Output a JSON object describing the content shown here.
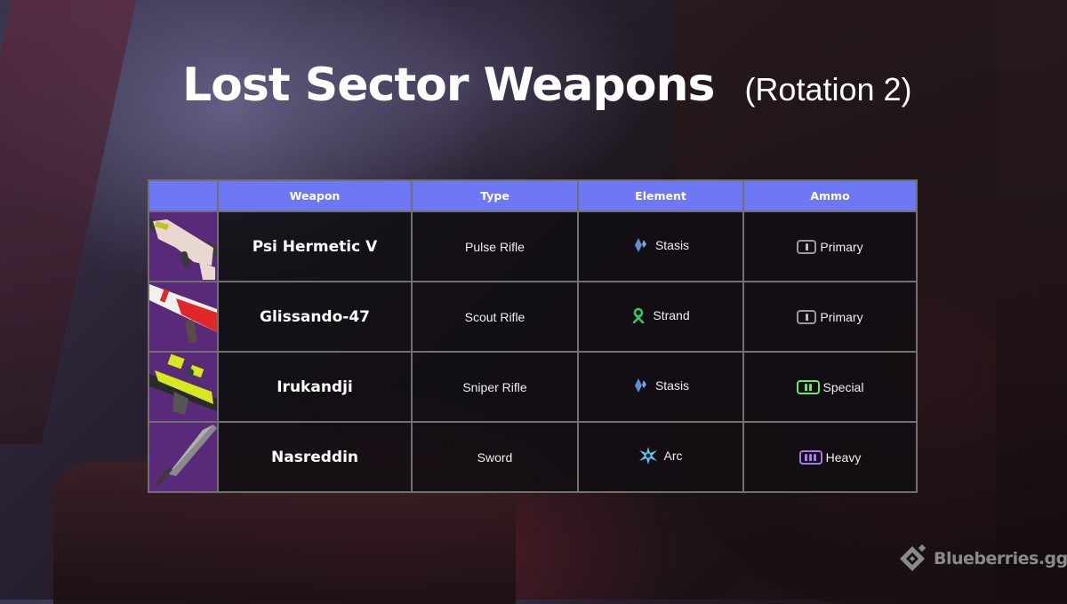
{
  "header": {
    "title": "Lost Sector Weapons",
    "subtitle": "(Rotation 2)"
  },
  "table": {
    "columns": [
      "",
      "Weapon",
      "Type",
      "Element",
      "Ammo"
    ],
    "rows": [
      {
        "weapon": "Psi Hermetic V",
        "type": "Pulse Rifle",
        "element": "Stasis",
        "element_icon": "stasis-icon",
        "ammo": "Primary",
        "ammo_icon": "primary-ammo-icon"
      },
      {
        "weapon": "Glissando-47",
        "type": "Scout Rifle",
        "element": "Strand",
        "element_icon": "strand-icon",
        "ammo": "Primary",
        "ammo_icon": "primary-ammo-icon"
      },
      {
        "weapon": "Irukandji",
        "type": "Sniper Rifle",
        "element": "Stasis",
        "element_icon": "stasis-icon",
        "ammo": "Special",
        "ammo_icon": "special-ammo-icon"
      },
      {
        "weapon": "Nasreddin",
        "type": "Sword",
        "element": "Arc",
        "element_icon": "arc-icon",
        "ammo": "Heavy",
        "ammo_icon": "heavy-ammo-icon"
      }
    ]
  },
  "colors": {
    "header_bg": "#6e78f4",
    "stasis": "#5b8fd6",
    "strand": "#35c46a",
    "arc": "#5cc8f0",
    "primary_ammo": "#9a9a9a",
    "special_ammo": "#6ee86e",
    "heavy_ammo": "#a878f0",
    "weapon_tile_bg": "#5a2a7a"
  },
  "branding": {
    "logo_text": "Blueberries.gg"
  }
}
